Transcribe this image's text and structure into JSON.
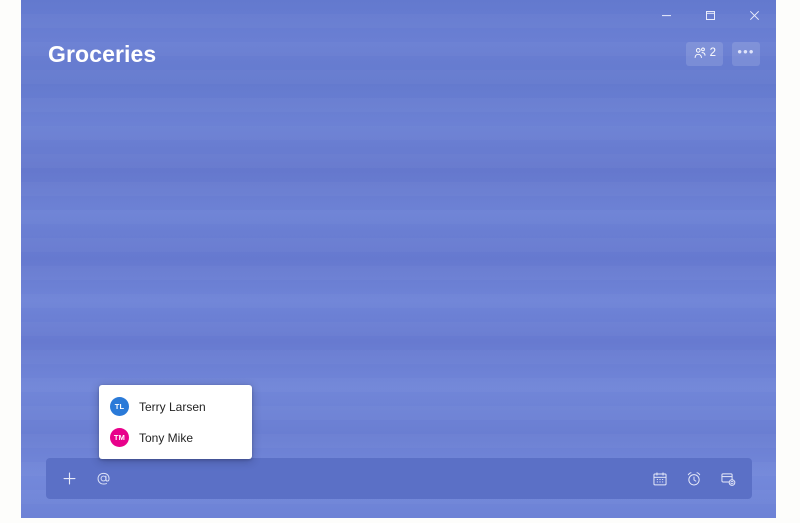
{
  "window": {
    "controls": [
      {
        "name": "minimize",
        "glyph": "minimize-icon",
        "tooltip": "Minimize"
      },
      {
        "name": "maximize",
        "glyph": "restore-icon",
        "tooltip": "Restore"
      },
      {
        "name": "close",
        "glyph": "close-icon",
        "tooltip": "Close"
      }
    ]
  },
  "header": {
    "title": "Groceries",
    "share": {
      "icon": "people-icon",
      "count": "2"
    },
    "more": {
      "icon": "more-horizontal-icon",
      "label": "•••"
    }
  },
  "mention_popup": {
    "visible": true,
    "people": [
      {
        "initials": "TL",
        "name": "Terry Larsen",
        "color": "#2a7ad8"
      },
      {
        "initials": "TM",
        "name": "Tony Mike",
        "color": "#e8008b"
      }
    ]
  },
  "composer": {
    "placeholder": "",
    "value": "",
    "left_actions": [
      {
        "name": "add-task",
        "icon": "plus-icon",
        "label": "+"
      },
      {
        "name": "mention",
        "icon": "at-icon",
        "label": "@"
      }
    ],
    "right_actions": [
      {
        "name": "due-date",
        "icon": "calendar-icon"
      },
      {
        "name": "reminder",
        "icon": "alarm-clock-icon"
      },
      {
        "name": "repeat",
        "icon": "repeat-icon"
      }
    ]
  },
  "colors": {
    "window_bg_top": "#6379ce",
    "window_bg_bottom": "#7388da",
    "composer_bg": "#5b70c6",
    "accent_blue": "#2a7ad8",
    "accent_pink": "#e8008b",
    "text_on_dark": "#ffffff",
    "text_primary": "#242424",
    "page_bg": "#fdfdfb"
  }
}
